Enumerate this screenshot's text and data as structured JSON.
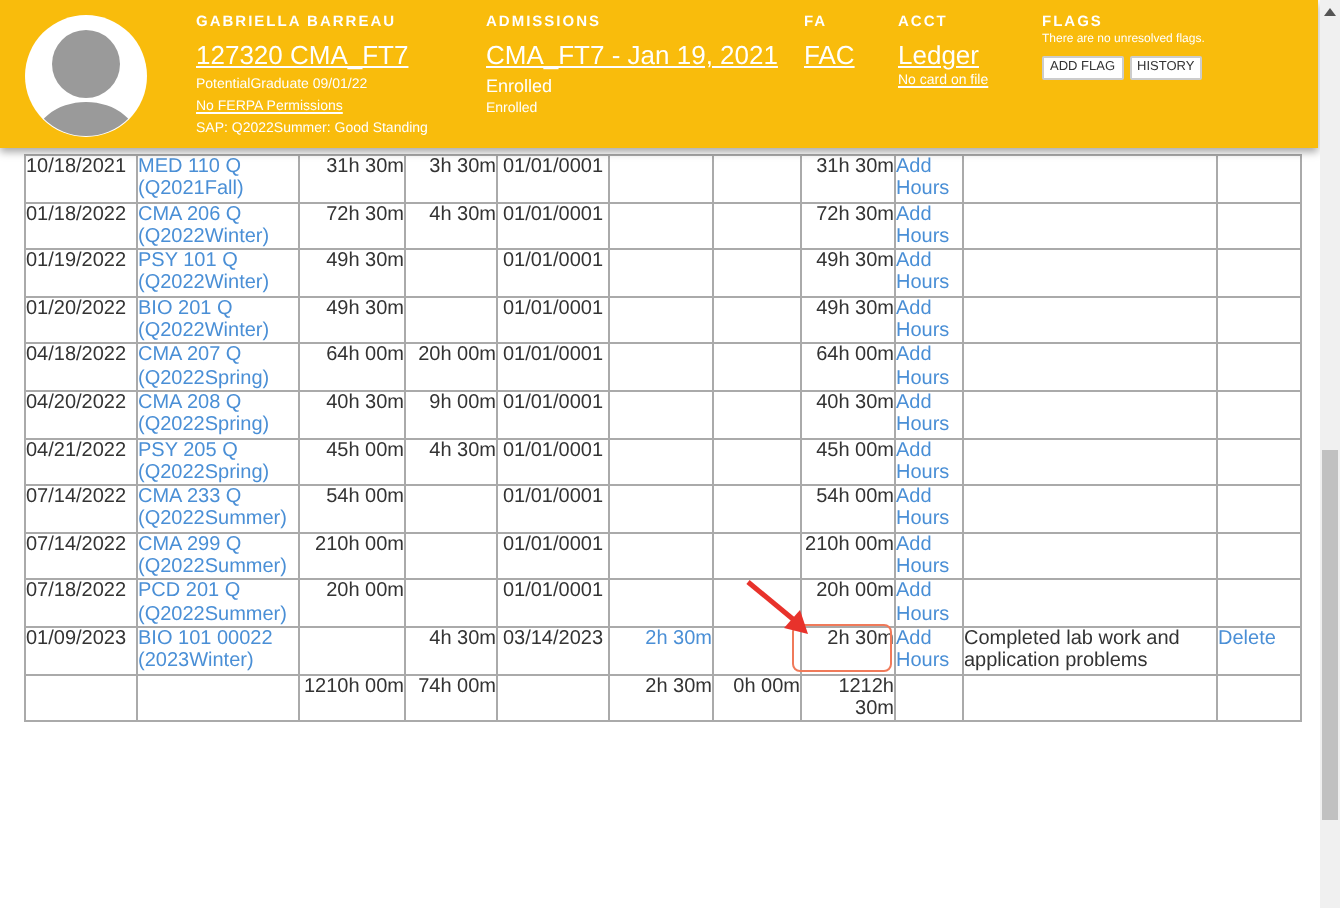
{
  "header": {
    "student": {
      "label": "GABRIELLA BARREAU",
      "link": "127320 CMA_FT7",
      "lines": [
        "PotentialGraduate 09/01/22"
      ],
      "ferpa_link": "No FERPA Permissions",
      "sap": "SAP: Q2022Summer: Good Standing"
    },
    "admissions": {
      "label": "ADMISSIONS",
      "link": "CMA_FT7 - Jan 19, 2021",
      "status": "Enrolled",
      "substatus": "Enrolled"
    },
    "fa": {
      "label": "FA",
      "link": "FAC"
    },
    "acct": {
      "label": "ACCT",
      "link": "Ledger",
      "card_link": "No card on file"
    },
    "flags": {
      "label": "FLAGS",
      "message": "There are no unresolved flags.",
      "buttons": [
        "ADD FLAG",
        "HISTORY"
      ]
    }
  },
  "table": {
    "rows": [
      {
        "date": "10/18/2021",
        "course": "MED 110 Q (Q2021Fall)",
        "column_3": "31h 30m",
        "column_4": "3h 30m",
        "column_5": "01/01/0001",
        "column_6": null,
        "column_7": null,
        "column_8": "31h 30m",
        "action": "Add Hours",
        "notes": null,
        "delete": null
      },
      {
        "date": "01/18/2022",
        "course": "CMA 206 Q (Q2022Winter)",
        "column_3": "72h 30m",
        "column_4": "4h 30m",
        "column_5": "01/01/0001",
        "column_6": null,
        "column_7": null,
        "column_8": "72h 30m",
        "action": "Add Hours",
        "notes": null,
        "delete": null
      },
      {
        "date": "01/19/2022",
        "course": "PSY 101 Q (Q2022Winter)",
        "column_3": "49h 30m",
        "column_4": null,
        "column_5": "01/01/0001",
        "column_6": null,
        "column_7": null,
        "column_8": "49h 30m",
        "action": "Add Hours",
        "notes": null,
        "delete": null
      },
      {
        "date": "01/20/2022",
        "course": "BIO 201 Q (Q2022Winter)",
        "column_3": "49h 30m",
        "column_4": null,
        "column_5": "01/01/0001",
        "column_6": null,
        "column_7": null,
        "column_8": "49h 30m",
        "action": "Add Hours",
        "notes": null,
        "delete": null
      },
      {
        "date": "04/18/2022",
        "course": "CMA 207 Q (Q2022Spring)",
        "column_3": "64h 00m",
        "column_4": "20h 00m",
        "column_5": "01/01/0001",
        "column_6": null,
        "column_7": null,
        "column_8": "64h 00m",
        "action": "Add Hours",
        "notes": null,
        "delete": null
      },
      {
        "date": "04/20/2022",
        "course": "CMA 208 Q (Q2022Spring)",
        "column_3": "40h 30m",
        "column_4": "9h 00m",
        "column_5": "01/01/0001",
        "column_6": null,
        "column_7": null,
        "column_8": "40h 30m",
        "action": "Add Hours",
        "notes": null,
        "delete": null
      },
      {
        "date": "04/21/2022",
        "course": "PSY 205 Q (Q2022Spring)",
        "column_3": "45h 00m",
        "column_4": "4h 30m",
        "column_5": "01/01/0001",
        "column_6": null,
        "column_7": null,
        "column_8": "45h 00m",
        "action": "Add Hours",
        "notes": null,
        "delete": null
      },
      {
        "date": "07/14/2022",
        "course": "CMA 233 Q (Q2022Summer)",
        "column_3": "54h 00m",
        "column_4": null,
        "column_5": "01/01/0001",
        "column_6": null,
        "column_7": null,
        "column_8": "54h 00m",
        "action": "Add Hours",
        "notes": null,
        "delete": null
      },
      {
        "date": "07/14/2022",
        "course": "CMA 299 Q (Q2022Summer)",
        "column_3": "210h 00m",
        "column_4": null,
        "column_5": "01/01/0001",
        "column_6": null,
        "column_7": null,
        "column_8": "210h 00m",
        "action": "Add Hours",
        "notes": null,
        "delete": null
      },
      {
        "date": "07/18/2022",
        "course": "PCD 201 Q (Q2022Summer)",
        "column_3": "20h 00m",
        "column_4": null,
        "column_5": "01/01/0001",
        "column_6": null,
        "column_7": null,
        "column_8": "20h 00m",
        "action": "Add Hours",
        "notes": null,
        "delete": null
      },
      {
        "date": "01/09/2023",
        "course": "BIO 101 00022 (2023Winter)",
        "column_3": null,
        "column_4": "4h 30m",
        "column_5": "03/14/2023",
        "column_6": "2h 30m",
        "column_7": null,
        "column_8": "2h 30m",
        "action": "Add Hours",
        "notes": "Completed lab work and application problems",
        "delete": "Delete",
        "highlighted": true
      }
    ],
    "totals": {
      "column_3": "1210h 00m",
      "column_4": "74h 00m",
      "column_6": "2h 30m",
      "column_7": "0h 00m",
      "column_8": "1212h 30m"
    }
  }
}
